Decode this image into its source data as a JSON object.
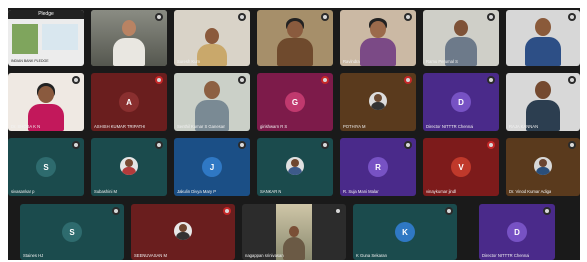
{
  "meeting": {
    "pin_title": "Pledge",
    "pin_caption": "INDIAN BANK PLEDGE",
    "tiles_row1": [
      {
        "name": "",
        "avatar": ""
      },
      {
        "name": "",
        "avatar": ""
      },
      {
        "name": "Suresh Kum",
        "avatar": ""
      },
      {
        "name": "",
        "avatar": ""
      },
      {
        "name": "Ravindra",
        "avatar": ""
      },
      {
        "name": "Ramu Perumal S",
        "avatar": ""
      },
      {
        "name": "",
        "avatar": ""
      }
    ],
    "tiles_row2": [
      {
        "name": "Dr. SHOBA K N",
        "avatar": ""
      },
      {
        "name": "ASHISH KUMAR TRIPATHI",
        "avatar": "A"
      },
      {
        "name": "Senthil Kumar S Ganesan",
        "avatar": ""
      },
      {
        "name": "girishwarn R S",
        "avatar": "G"
      },
      {
        "name": "POTHIYA M",
        "avatar": ""
      },
      {
        "name": "Director NITTTR Chennai",
        "avatar": "D"
      },
      {
        "name": "RAJA KANNAN",
        "avatar": ""
      }
    ],
    "tiles_row3": [
      {
        "name": "sivasankar p",
        "avatar": "S"
      },
      {
        "name": "Subashini M",
        "avatar": ""
      },
      {
        "name": "Jakulin Divya Mary P",
        "avatar": "J"
      },
      {
        "name": "SANKAR N",
        "avatar": ""
      },
      {
        "name": "R. Suja Mani Malar",
        "avatar": "R"
      },
      {
        "name": "vinaykumar jindl",
        "avatar": "V"
      },
      {
        "name": "Dr. Vinod Kumar Adiga",
        "avatar": ""
      }
    ],
    "tiles_row4": [
      {
        "name": "Staines HJ",
        "avatar": "S"
      },
      {
        "name": "SEENUVASAN M",
        "avatar": ""
      },
      {
        "name": "nagappan srinivasan",
        "avatar": ""
      },
      {
        "name": "K Guna Sekaran",
        "avatar": "K"
      },
      {
        "name": "Director NITTTR Chennai",
        "avatar": "D"
      }
    ],
    "colors": {
      "background": "#1a1a1a",
      "tile_dark": "#2c2c2c",
      "teal": "#1b4b4d",
      "maroon": "#6a1e1e",
      "magenta": "#7d1b4a",
      "brown": "#5a3a1d",
      "purple": "#4a2a8a",
      "blue": "#1b4f86",
      "muted_red": "#c62828"
    }
  }
}
